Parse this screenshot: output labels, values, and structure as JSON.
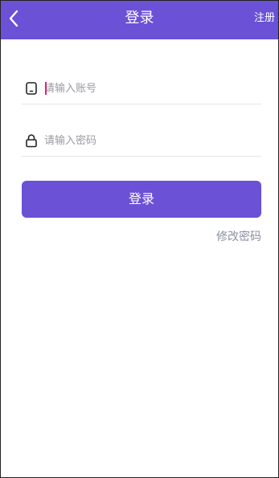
{
  "header": {
    "title": "登录",
    "register_label": "注册",
    "back_icon": "chevron-left-icon",
    "color": "#6a51d6"
  },
  "form": {
    "account": {
      "placeholder": "请输入账号",
      "value": "",
      "icon": "phone-icon"
    },
    "password": {
      "placeholder": "请输入密码",
      "value": "",
      "icon": "lock-icon"
    },
    "login_label": "登录",
    "change_password_label": "修改密码"
  }
}
